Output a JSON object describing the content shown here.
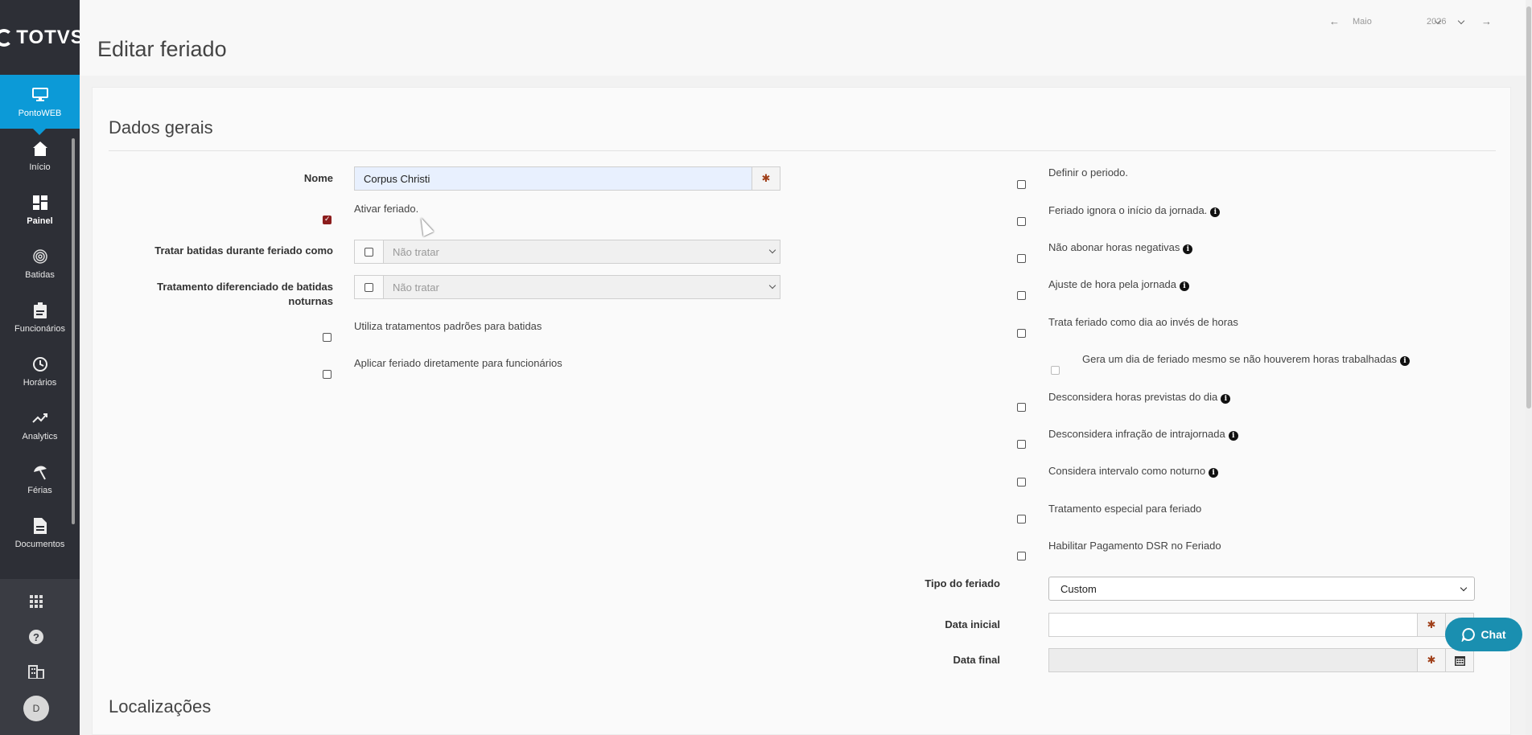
{
  "sidebar": {
    "logo": "TOTVS",
    "items": [
      {
        "label": "PontoWEB",
        "icon": "monitor-icon"
      },
      {
        "label": "Início",
        "icon": "home-icon"
      },
      {
        "label": "Painel",
        "icon": "dashboard-icon"
      },
      {
        "label": "Batidas",
        "icon": "fingerprint-icon"
      },
      {
        "label": "Funcionários",
        "icon": "badge-icon"
      },
      {
        "label": "Horários",
        "icon": "clock-icon"
      },
      {
        "label": "Analytics",
        "icon": "trend-icon"
      },
      {
        "label": "Férias",
        "icon": "beach-umbrella-icon"
      },
      {
        "label": "Documentos",
        "icon": "document-icon"
      }
    ],
    "avatar_letter": "D"
  },
  "header": {
    "title": "Editar feriado",
    "period": {
      "month": "Maio",
      "year": "2026"
    }
  },
  "sections": {
    "general": "Dados gerais",
    "locations": "Localizações"
  },
  "form": {
    "nome_label": "Nome",
    "nome_value": "Corpus Christi",
    "ativar_label": "Ativar feriado.",
    "tratar_label": "Tratar batidas durante feriado como",
    "tratar_value": "Não tratar",
    "noturnas_label_1": "Tratamento diferenciado de batidas",
    "noturnas_label_2": "noturnas",
    "noturnas_value": "Não tratar",
    "padroes_label": "Utiliza tratamentos padrões para batidas",
    "aplicar_label": "Aplicar feriado diretamente para funcionários"
  },
  "right": {
    "definir": "Definir o periodo.",
    "ignora": "Feriado ignora o início da jornada.",
    "nao_abonar": "Não abonar horas negativas",
    "ajuste": "Ajuste de hora pela jornada",
    "trata_dia": "Trata feriado como dia ao invés de horas",
    "gera_dia": "Gera um dia de feriado mesmo se não houverem horas trabalhadas",
    "desconsidera_prev": "Desconsidera horas previstas do dia",
    "desconsidera_intra": "Desconsidera infração de intrajornada",
    "intervalo": "Considera intervalo como noturno",
    "especial": "Tratamento especial para feriado",
    "dsr": "Habilitar Pagamento DSR no Feriado",
    "tipo_label": "Tipo do feriado",
    "tipo_value": "Custom",
    "data_inicial_label": "Data inicial",
    "data_final_label": "Data final"
  },
  "chat": {
    "label": "Chat"
  }
}
